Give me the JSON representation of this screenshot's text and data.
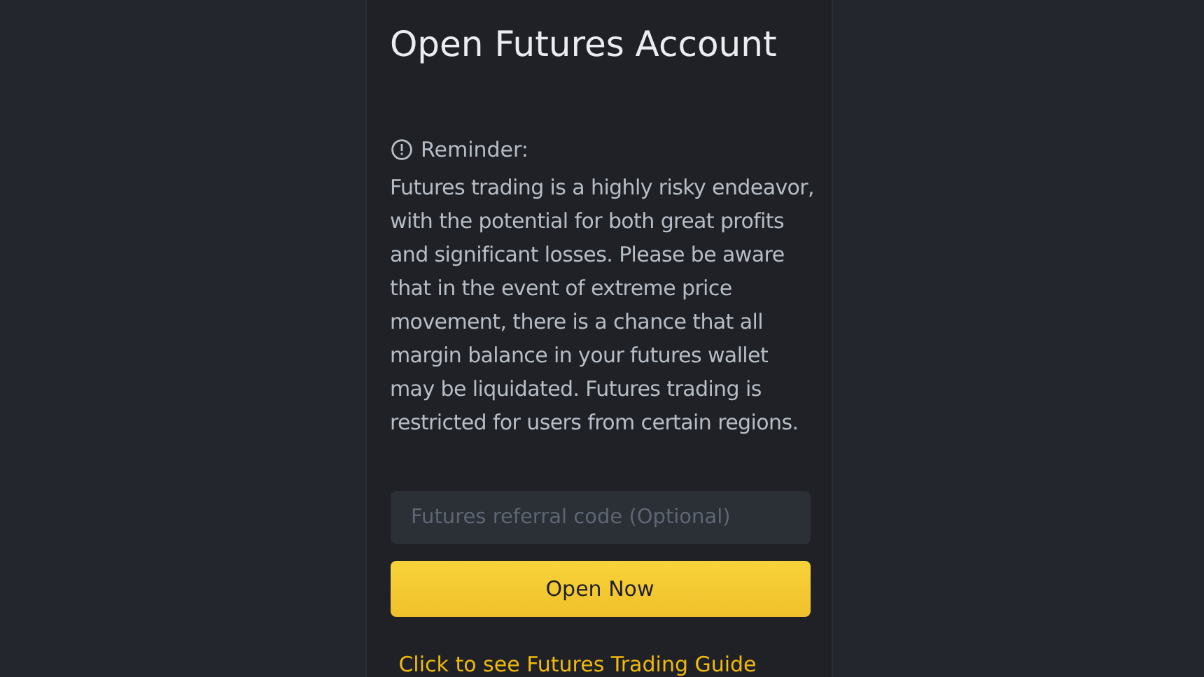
{
  "title": "Open Futures Account",
  "reminder": {
    "label": "Reminder:",
    "text": "Futures trading is a highly risky endeavor, with the potential for both great profits and significant losses. Please be aware that in the event of extreme price movement, there is a chance that all margin balance in your futures wallet may be liquidated. Futures trading is restricted for users from certain regions."
  },
  "referral_field": {
    "placeholder": "Futures referral code (Optional)"
  },
  "primary_button": "Open Now",
  "guide_link": "Click to see Futures Trading Guide"
}
